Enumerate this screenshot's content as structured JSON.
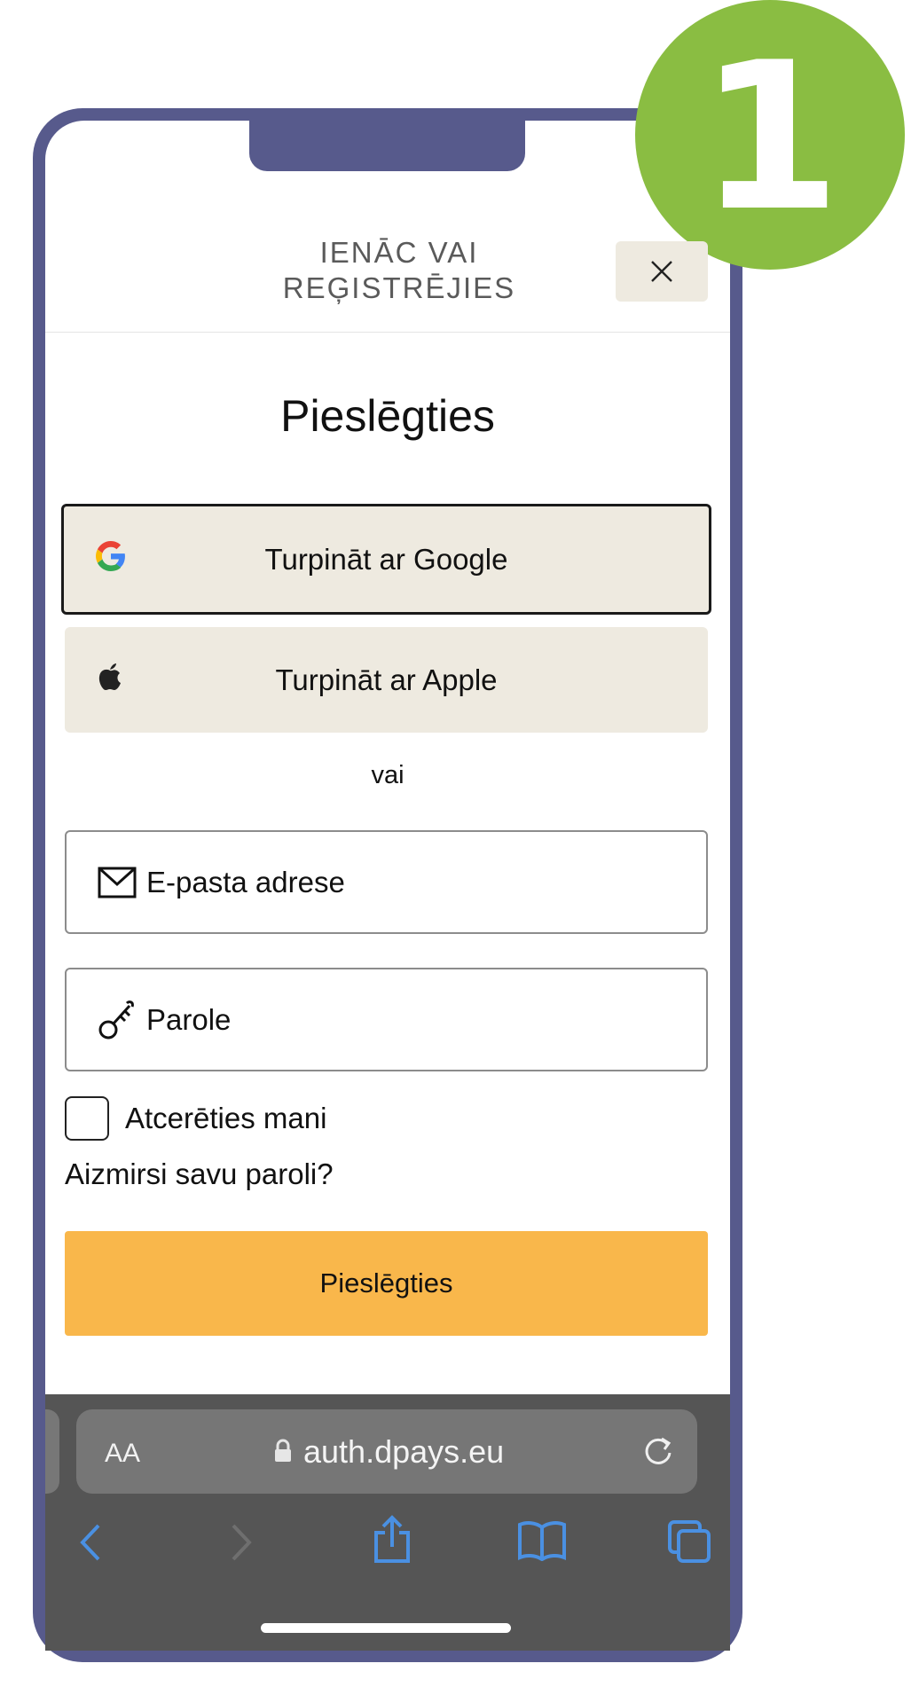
{
  "step_badge": "1",
  "header": {
    "title_line1": "IENĀC VAI",
    "title_line2": "REĢISTRĒJIES",
    "close_icon": "close-icon"
  },
  "page_title": "Pieslēgties",
  "social": {
    "google_label": "Turpināt ar Google",
    "apple_label": "Turpināt ar Apple"
  },
  "divider_text": "vai",
  "form": {
    "email_placeholder": "E-pasta adrese",
    "password_placeholder": "Parole",
    "remember_label": "Atcerēties mani",
    "forgot_link": "Aizmirsi savu paroli?",
    "submit_label": "Pieslēgties"
  },
  "browser": {
    "text_size_label": "AA",
    "url": "auth.dpays.eu"
  },
  "colors": {
    "phone_frame": "#575a8c",
    "badge": "#8abd42",
    "social_button": "#eeeae0",
    "submit_button": "#f9b74b",
    "toolbar": "#555555",
    "toolbar_icon": "#4a90e2"
  }
}
